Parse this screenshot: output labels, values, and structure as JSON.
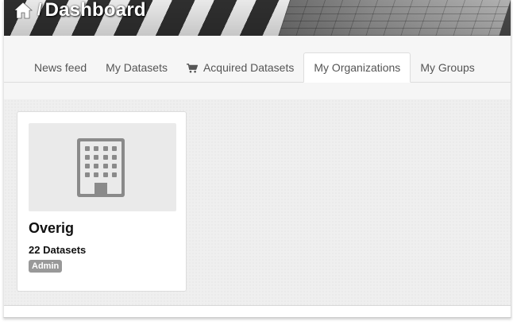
{
  "breadcrumb": {
    "home_icon": "home-icon",
    "separator": "/",
    "title": "Dashboard"
  },
  "tabs": [
    {
      "label": "News feed",
      "active": false
    },
    {
      "label": "My Datasets",
      "active": false
    },
    {
      "label": "Acquired Datasets",
      "icon": "cart-icon",
      "active": false
    },
    {
      "label": "My Organizations",
      "active": true
    },
    {
      "label": "My Groups",
      "active": false
    }
  ],
  "organizations": [
    {
      "icon": "building-icon",
      "name": "Overig",
      "datasets": "22 Datasets",
      "role": "Admin"
    }
  ],
  "colors": {
    "badge_bg": "#999999",
    "content_bg": "#efefef",
    "tab_text": "#555555"
  }
}
